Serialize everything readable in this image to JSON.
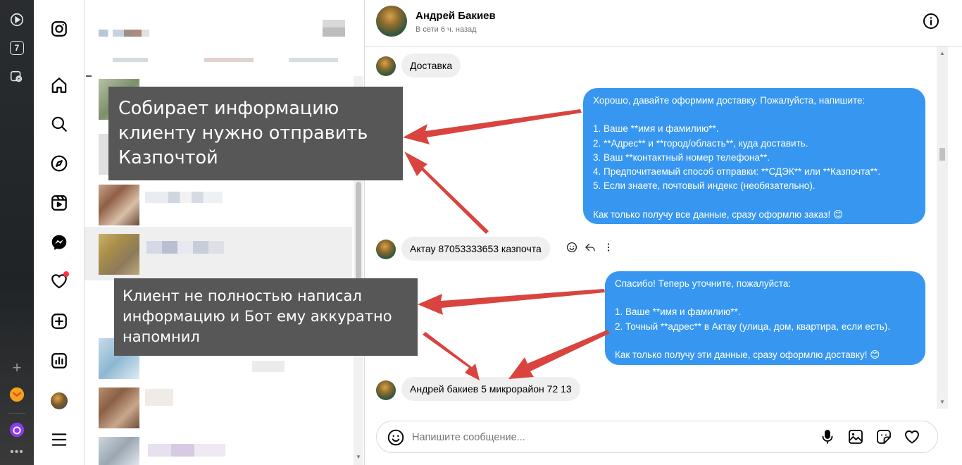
{
  "contact": {
    "name": "Андрей Бакиев",
    "status": "В сети 6 ч. назад"
  },
  "messages": [
    {
      "direction": "in",
      "text": "Доставка"
    },
    {
      "direction": "out",
      "text": "Хорошо, давайте оформим доставку. Пожалуйста, напишите:\n\n1. Ваше **имя и фамилию**.\n2. **Адрес** и **город/область**, куда доставить.\n3. Ваш **контактный номер телефона**.\n4. Предпочитаемый способ отправки: **СДЭК** или **Казпочта**.\n5. Если знаете, почтовый индекс (необязательно).\n\nКак только получу все данные, сразу оформлю заказ! 😊"
    },
    {
      "direction": "in",
      "text": "Актау  87053333653 казпочта"
    },
    {
      "direction": "out",
      "text": "Спасибо! Теперь уточните, пожалуйста:\n\n1. Ваше **имя и фамилию**.\n2. Точный **адрес** в Актау (улица, дом, квартира, если есть).\n\nКак только получу эти данные, сразу оформлю доставку! 😊"
    },
    {
      "direction": "in",
      "text": "Андрей бакиев 5 микрорайон 72 13"
    }
  ],
  "composer": {
    "placeholder": "Напишите сообщение..."
  },
  "annotations": {
    "note1": "Собирает информацию клиенту нужно отправить Казпочтой",
    "note2": "Клиент не полностью написал информацию и Бот ему аккуратно напомнил"
  },
  "browser_sidebar": {
    "tab_badge": "7"
  },
  "colors": {
    "outgoing_bubble": "#3797f0",
    "incoming_bubble": "#efefef",
    "annotation_box": "#575757",
    "annotation_arrow": "#d9443f",
    "notification_dot": "#ff3040"
  },
  "icons": {
    "nav": [
      "instagram-icon",
      "home-icon",
      "search-icon",
      "explore-icon",
      "reels-icon",
      "messenger-icon",
      "heart-icon",
      "create-icon",
      "stats-icon",
      "menu-icon"
    ],
    "composer": [
      "emoji-icon",
      "microphone-icon",
      "image-icon",
      "sticker-icon",
      "heart-icon"
    ]
  }
}
